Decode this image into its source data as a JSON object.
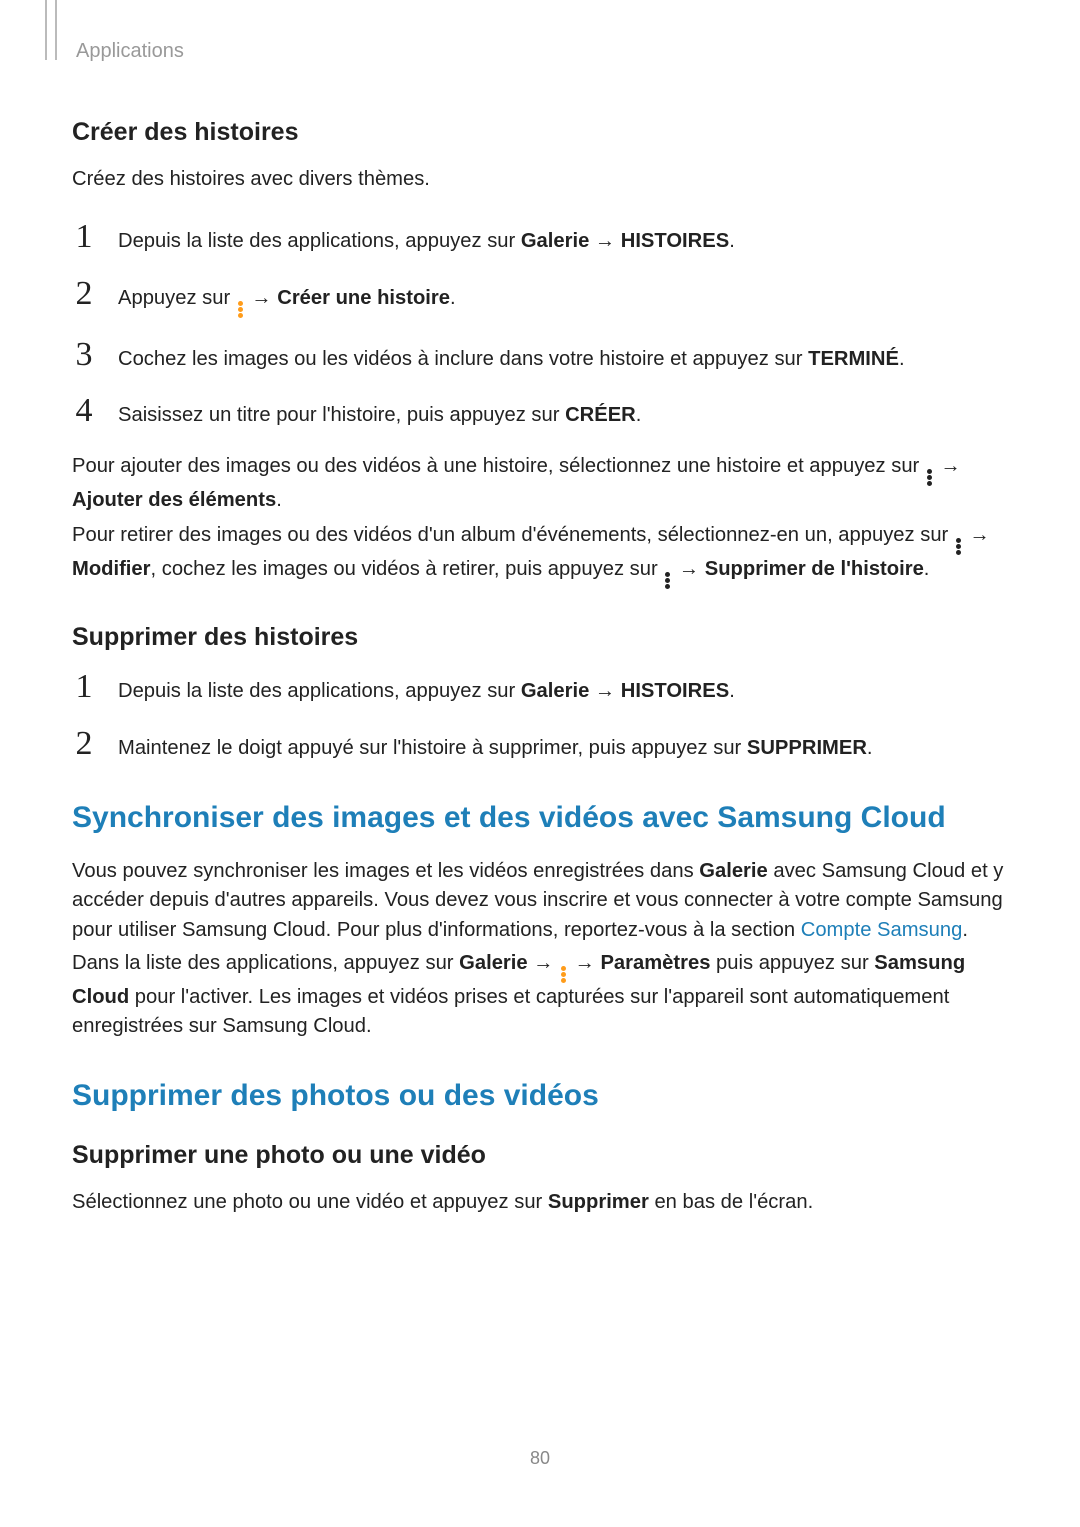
{
  "header": {
    "chapter": "Applications"
  },
  "sections": {
    "createStories": {
      "heading": "Créer des histoires",
      "intro": "Créez des histoires avec divers thèmes.",
      "steps": {
        "s1_prefix": "Depuis la liste des applications, appuyez sur ",
        "s1_bold1": "Galerie",
        "s1_arrow": " → ",
        "s1_bold2": "HISTOIRES",
        "s1_suffix": ".",
        "s2_prefix": "Appuyez sur ",
        "s2_arrow": " → ",
        "s2_bold": "Créer une histoire",
        "s2_suffix": ".",
        "s3_prefix": "Cochez les images ou les vidéos à inclure dans votre histoire et appuyez sur ",
        "s3_bold": "TERMINÉ",
        "s3_suffix": ".",
        "s4_prefix": "Saisissez un titre pour l'histoire, puis appuyez sur ",
        "s4_bold": "CRÉER",
        "s4_suffix": "."
      },
      "note1_prefix": "Pour ajouter des images ou des vidéos à une histoire, sélectionnez une histoire et appuyez sur ",
      "note1_arrow": " → ",
      "note1_bold": "Ajouter des éléments",
      "note1_suffix": ".",
      "note2_line1": "Pour retirer des images ou des vidéos d'un album d'événements, sélectionnez-en un, appuyez sur ",
      "note2_arrow1": " → ",
      "note2_bold1": "Modifier",
      "note2_mid": ", cochez les images ou vidéos à retirer, puis appuyez sur ",
      "note2_arrow2": " → ",
      "note2_bold2": "Supprimer de l'histoire",
      "note2_suffix": "."
    },
    "deleteStories": {
      "heading": "Supprimer des histoires",
      "steps": {
        "s1_prefix": "Depuis la liste des applications, appuyez sur ",
        "s1_bold1": "Galerie",
        "s1_arrow": " → ",
        "s1_bold2": "HISTOIRES",
        "s1_suffix": ".",
        "s2_prefix": "Maintenez le doigt appuyé sur l'histoire à supprimer, puis appuyez sur ",
        "s2_bold": "SUPPRIMER",
        "s2_suffix": "."
      }
    },
    "sync": {
      "heading": "Synchroniser des images et des vidéos avec Samsung Cloud",
      "p1_a": "Vous pouvez synchroniser les images et les vidéos enregistrées dans ",
      "p1_bold": "Galerie",
      "p1_b": " avec Samsung Cloud et y accéder depuis d'autres appareils. Vous devez vous inscrire et vous connecter à votre compte Samsung pour utiliser Samsung Cloud. Pour plus d'informations, reportez-vous à la section ",
      "p1_link": "Compte Samsung",
      "p1_suffix": ".",
      "p2_a": "Dans la liste des applications, appuyez sur ",
      "p2_bold1": "Galerie",
      "p2_arr1": " → ",
      "p2_arr2": " → ",
      "p2_bold2": "Paramètres",
      "p2_b": " puis appuyez sur ",
      "p2_bold3": "Samsung Cloud",
      "p2_c": " pour l'activer. Les images et vidéos prises et capturées sur l'appareil sont automatiquement enregistrées sur Samsung Cloud."
    },
    "deleteMedia": {
      "heading": "Supprimer des photos ou des vidéos",
      "sub": "Supprimer une photo ou une vidéo",
      "p_a": "Sélectionnez une photo ou une vidéo et appuyez sur ",
      "p_bold": "Supprimer",
      "p_b": " en bas de l'écran."
    }
  },
  "pageNumber": "80"
}
